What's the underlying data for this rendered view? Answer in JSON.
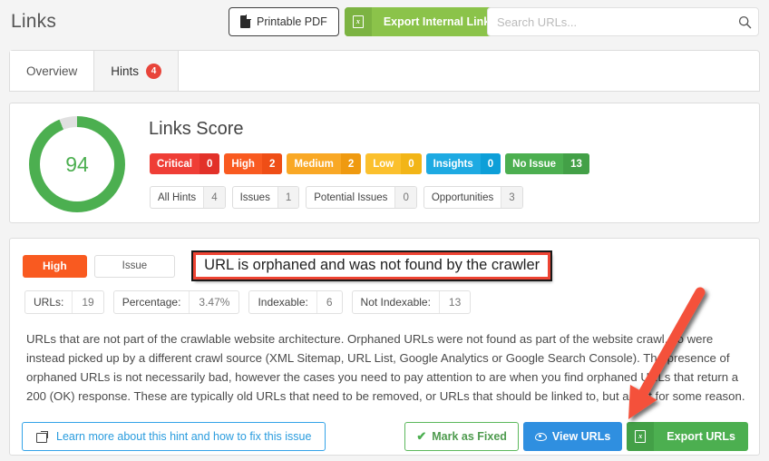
{
  "header": {
    "title": "Links",
    "printable_pdf_label": "Printable PDF",
    "export_internal_links_label": "Export Internal Links",
    "search_placeholder": "Search URLs...",
    "search_value": ""
  },
  "tabs": [
    {
      "label": "Overview",
      "badge": "",
      "active": false
    },
    {
      "label": "Hints",
      "badge": "4",
      "active": true
    }
  ],
  "score_card": {
    "title": "Links Score",
    "score": "94",
    "score_percent": 94,
    "ring_color": "#4caf50",
    "ring_track_color": "#e0e0e0",
    "severities": [
      {
        "name": "Critical",
        "count": "0",
        "color": "#ef3e36",
        "count_color": "#e23129"
      },
      {
        "name": "High",
        "count": "2",
        "color": "#f95a20",
        "count_color": "#ef4e16"
      },
      {
        "name": "Medium",
        "count": "2",
        "color": "#f9a825",
        "count_color": "#ef9a10"
      },
      {
        "name": "Low",
        "count": "0",
        "color": "#fbc02d",
        "count_color": "#f2b517"
      },
      {
        "name": "Insights",
        "count": "0",
        "color": "#1eaae2",
        "count_color": "#0d9fd8"
      },
      {
        "name": "No Issue",
        "count": "13",
        "color": "#4caf50",
        "count_color": "#43a047"
      }
    ],
    "filters": [
      {
        "name": "All Hints",
        "count": "4"
      },
      {
        "name": "Issues",
        "count": "1"
      },
      {
        "name": "Potential Issues",
        "count": "0"
      },
      {
        "name": "Opportunities",
        "count": "3"
      }
    ]
  },
  "hint": {
    "severity_label": "High",
    "type_label": "Issue",
    "title": "URL is orphaned and was not found by the crawler",
    "highlight_border_color": "#ee4433",
    "stats": [
      {
        "key": "URLs:",
        "value": "19"
      },
      {
        "key": "Percentage:",
        "value": "3.47%"
      },
      {
        "key": "Indexable:",
        "value": "6"
      },
      {
        "key": "Not Indexable:",
        "value": "13"
      }
    ],
    "description": "URLs that are not part of the crawlable website architecture. Orphaned URLs were not found as part of the website crawl, so were instead picked up by a different crawl source (XML Sitemap, URL List, Google Analytics or Google Search Console). The presence of orphaned URLs is not necessarily bad, however the cases you need to pay attention to are when you find orphaned URLs that return a 200 (OK) response. These are typically old URLs that need to be removed, or URLs that should be linked to, but aren't for some reason.",
    "learn_more_label": "Learn more about this hint and how to fix this issue",
    "mark_as_fixed_label": "Mark as Fixed",
    "view_urls_label": "View URLs",
    "export_urls_label": "Export URLs"
  },
  "annotation": {
    "arrow_color": "#f4513b",
    "points_to": "view-urls-button"
  }
}
